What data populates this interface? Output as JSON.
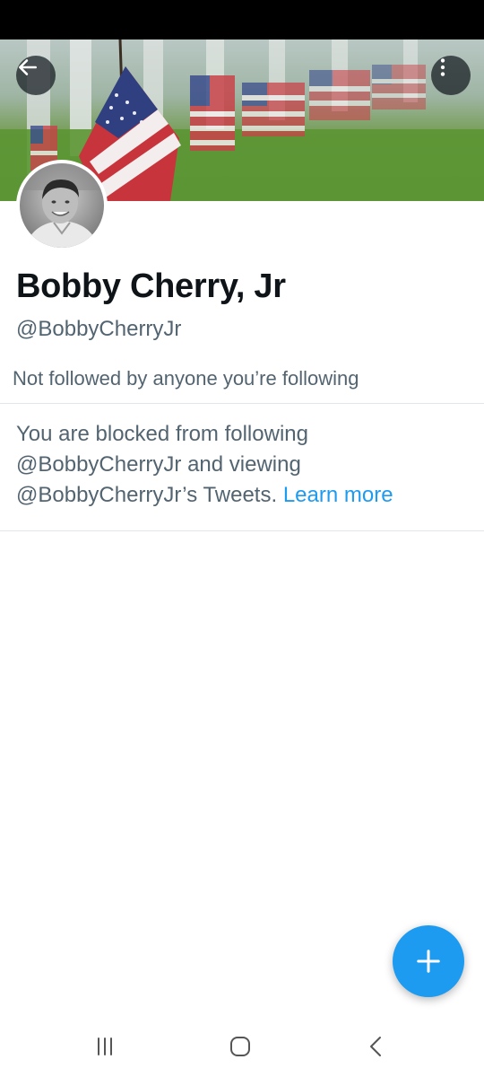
{
  "profile": {
    "display_name": "Bobby Cherry, Jr",
    "handle": "@BobbyCherryJr",
    "followed_by": "Not followed by anyone you’re following"
  },
  "blocked_notice": {
    "text": "You are blocked from following @BobbyCherryJr and viewing @BobbyCherryJr’s Tweets.",
    "link": "Learn more"
  },
  "icons": {
    "back": "arrow-left",
    "more": "more-vertical",
    "compose": "plus",
    "nav_recents": "recents-lines",
    "nav_home": "home-rounded-square",
    "nav_back": "chevron-left"
  },
  "colors": {
    "accent": "#1d9bf0",
    "text_primary": "#0f1419",
    "text_secondary": "#536471"
  }
}
